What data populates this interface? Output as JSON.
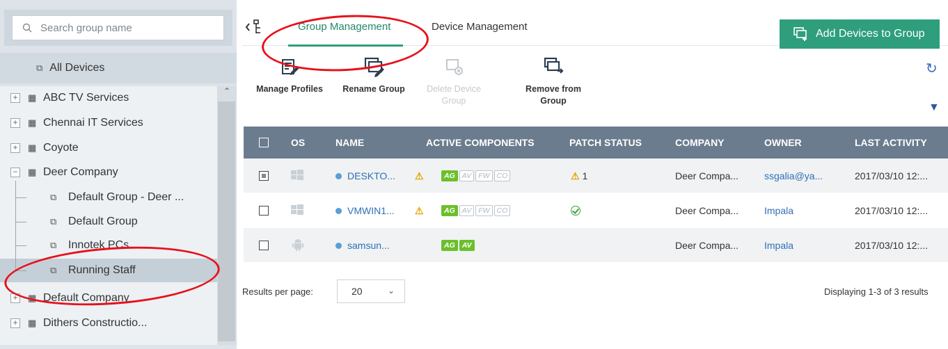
{
  "sidebar": {
    "search_placeholder": "Search group name",
    "all_devices": "All Devices",
    "tree": [
      {
        "label": "ABC TV Services",
        "expanded": false
      },
      {
        "label": "Chennai IT Services",
        "expanded": false
      },
      {
        "label": "Coyote",
        "expanded": false
      },
      {
        "label": "Deer Company",
        "expanded": true
      },
      {
        "label": "Default Group - Deer ..."
      },
      {
        "label": "Default Group"
      },
      {
        "label": "Innotek PCs"
      },
      {
        "label": "Running Staff",
        "selected": true
      },
      {
        "label": "Default Company",
        "expanded": false
      },
      {
        "label": "Dithers Constructio...",
        "expanded": false
      }
    ]
  },
  "tabs": {
    "group_management": "Group Management",
    "device_management": "Device Management"
  },
  "add_button": "Add Devices to Group",
  "toolbar": {
    "manage_profiles": "Manage Profiles",
    "rename_group": "Rename Group",
    "delete_device_line1": "Delete Device",
    "delete_device_line2": "Group",
    "remove_line1": "Remove from",
    "remove_line2": "Group"
  },
  "table": {
    "headers": {
      "os": "OS",
      "name": "NAME",
      "active_components": "ACTIVE COMPONENTS",
      "patch_status": "PATCH STATUS",
      "company": "COMPANY",
      "owner": "OWNER",
      "last_activity": "LAST ACTIVITY"
    },
    "rows": [
      {
        "name": "DESKTO...",
        "components": [
          "AG",
          "AV",
          "FW",
          "CO"
        ],
        "patch": "1",
        "company": "Deer Compa...",
        "owner": "ssgalia@ya...",
        "last_activity": "2017/03/10 12:..."
      },
      {
        "name": "VMWIN1...",
        "components": [
          "AG",
          "AV",
          "FW",
          "CO"
        ],
        "patch": "",
        "company": "Deer Compa...",
        "owner": "Impala",
        "last_activity": "2017/03/10 12:..."
      },
      {
        "name": "samsun...",
        "components": [
          "AG",
          "AV"
        ],
        "patch": "",
        "company": "Deer Compa...",
        "owner": "Impala",
        "last_activity": "2017/03/10 12:..."
      }
    ]
  },
  "footer": {
    "results_per_page_label": "Results per page:",
    "results_per_page_value": "20",
    "displaying": "Displaying 1-3 of 3 results"
  },
  "colors": {
    "accent": "#2e9e7c",
    "table_header": "#6b7c8e",
    "annotation": "#e8101b"
  }
}
